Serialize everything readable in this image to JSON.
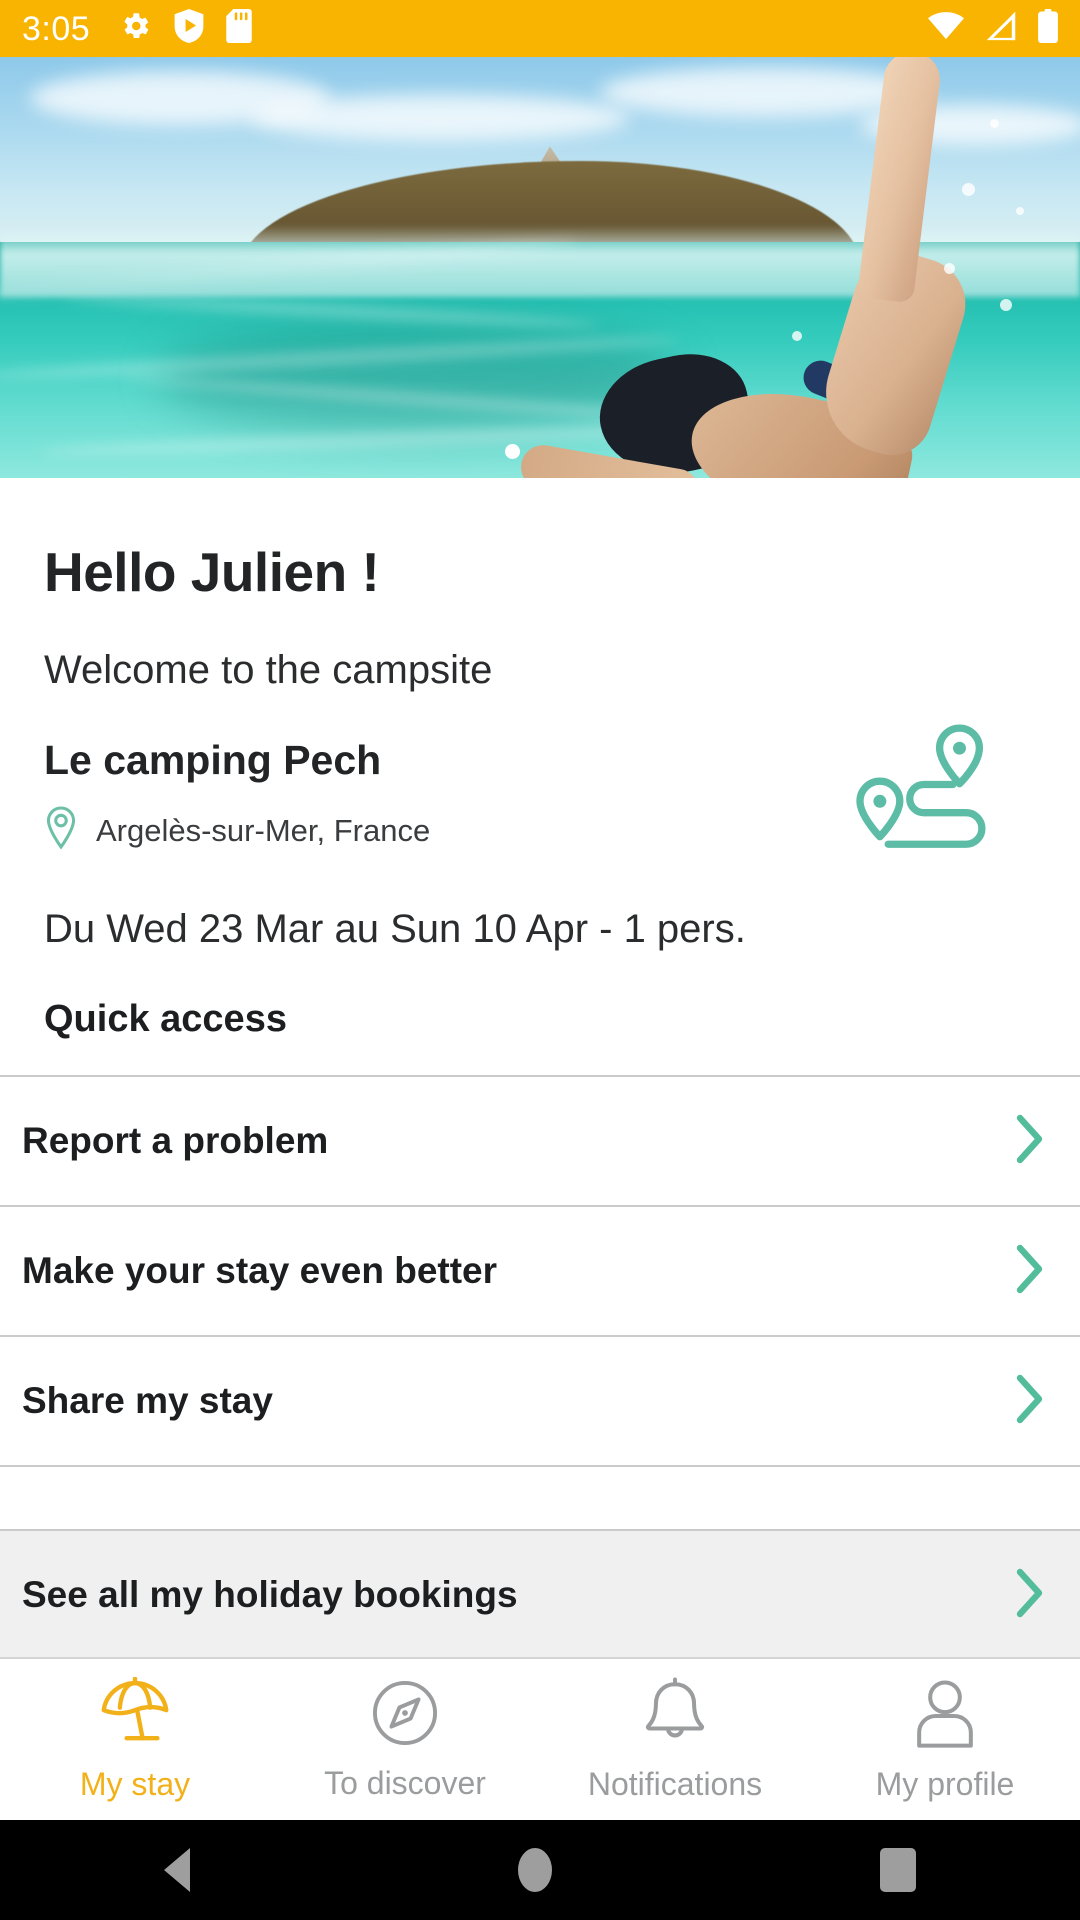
{
  "status_bar": {
    "time": "3:05",
    "left_icons": [
      "gear-icon",
      "shield-play-icon",
      "sd-card-icon"
    ],
    "right_icons": [
      "wifi-icon",
      "cellular-signal-icon",
      "battery-icon"
    ],
    "background_color": "#f8b400"
  },
  "hero": {
    "alt": "underwater-split-photo-swimmer",
    "carousel_dots": 1,
    "active_dot": 0
  },
  "main": {
    "greeting": "Hello Julien !",
    "welcome": "Welcome to the campsite",
    "campsite_name": "Le camping Pech",
    "campsite_location": "Argelès-sur-Mer, France",
    "location_pin_icon": "location-pin-icon",
    "route_icon": "route-map-icon",
    "dates": "Du Wed 23 Mar au Sun 10 Apr - 1 pers.",
    "quick_access_title": "Quick access"
  },
  "quick_access": {
    "items": [
      {
        "label": "Report a problem",
        "chevron": "chevron-right-icon"
      },
      {
        "label": "Make your stay even better",
        "chevron": "chevron-right-icon"
      },
      {
        "label": "Share my stay",
        "chevron": "chevron-right-icon"
      }
    ],
    "highlighted": {
      "label": "See all my holiday bookings",
      "chevron": "chevron-right-icon"
    }
  },
  "bottom_nav": {
    "items": [
      {
        "label": "My stay",
        "icon": "beach-umbrella-icon",
        "active": true
      },
      {
        "label": "To discover",
        "icon": "compass-icon",
        "active": false
      },
      {
        "label": "Notifications",
        "icon": "bell-icon",
        "active": false
      },
      {
        "label": "My profile",
        "icon": "person-icon",
        "active": false
      }
    ]
  },
  "android_nav": {
    "back": "back-triangle-icon",
    "home": "home-circle-icon",
    "recents": "recents-square-icon"
  },
  "colors": {
    "accent_amber": "#f2b019",
    "status_bar": "#f8b400",
    "teal": "#52bc9b",
    "inactive_gray": "#9a9c9e",
    "highlight_bg": "#f0f0f0"
  }
}
